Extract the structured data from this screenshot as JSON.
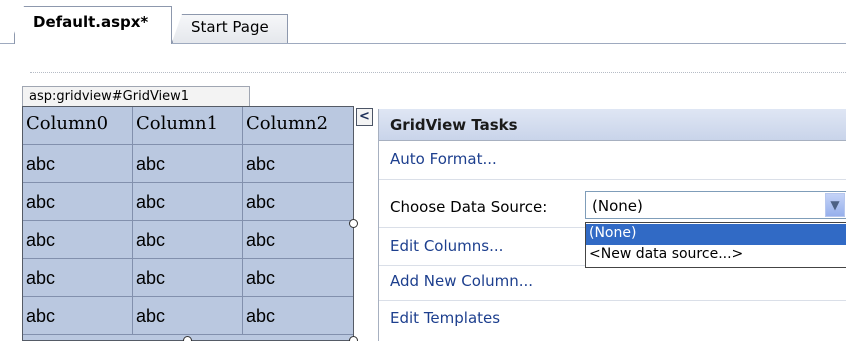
{
  "tabs": [
    {
      "label": "Default.aspx*",
      "active": true
    },
    {
      "label": "Start Page",
      "active": false
    }
  ],
  "control_tag": "asp:gridview#GridView1",
  "grid": {
    "columns": [
      "Column0",
      "Column1",
      "Column2"
    ],
    "rows": [
      [
        "abc",
        "abc",
        "abc"
      ],
      [
        "abc",
        "abc",
        "abc"
      ],
      [
        "abc",
        "abc",
        "abc"
      ],
      [
        "abc",
        "abc",
        "abc"
      ],
      [
        "abc",
        "abc",
        "abc"
      ]
    ]
  },
  "smart_tag_glyph": "<",
  "tasks_panel": {
    "title": "GridView Tasks",
    "auto_format": "Auto Format...",
    "choose_data_source_label": "Choose Data Source:",
    "data_source_value": "(None)",
    "data_source_options": [
      "(None)",
      "<New data source...>"
    ],
    "selected_option_index": 0,
    "edit_columns": "Edit Columns...",
    "add_new_column": "Add New Column...",
    "edit_templates": "Edit Templates"
  },
  "colors": {
    "grid_fill": "#bac8e0",
    "panel_header": "#c9d4ea",
    "link": "#1d3f8e",
    "selection": "#316ac5"
  },
  "icons": {
    "combo_arrow": "chevron-down-icon",
    "smart_tag": "chevron-left-icon"
  }
}
